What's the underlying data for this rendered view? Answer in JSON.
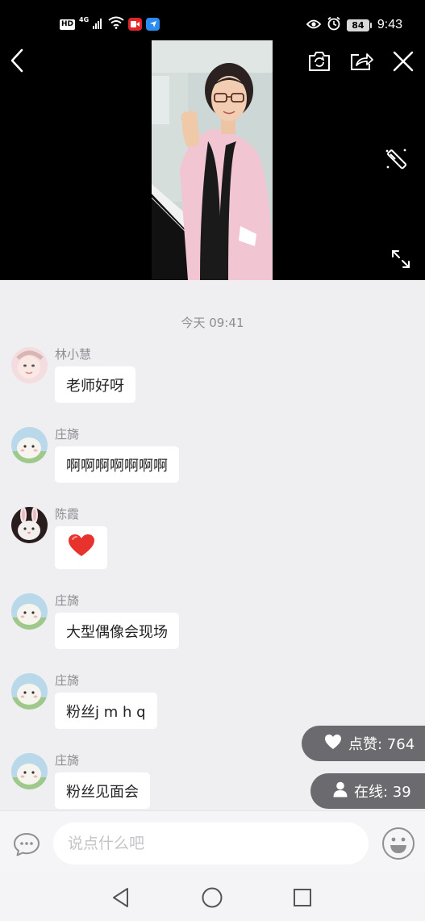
{
  "status_bar": {
    "hd": "HD",
    "network": "4G",
    "battery": "84",
    "time": "9:43"
  },
  "video": {
    "icons": [
      "back-icon",
      "switch-camera-icon",
      "share-icon",
      "close-icon",
      "beauty-wand-icon",
      "fullscreen-icon"
    ]
  },
  "chat": {
    "date_label": "今天 09:41",
    "messages": [
      {
        "sender": "林小慧",
        "text": "老师好呀",
        "avatar": "girl-avatar"
      },
      {
        "sender": "庄旖",
        "text": "啊啊啊啊啊啊啊",
        "avatar": "cartoon-avatar"
      },
      {
        "sender": "陈霞",
        "text": "",
        "sticker": "red-heart",
        "avatar": "bunny-avatar"
      },
      {
        "sender": "庄旖",
        "text": "大型偶像会现场",
        "avatar": "cartoon-avatar"
      },
      {
        "sender": "庄旖",
        "text": "粉丝j m h q",
        "avatar": "cartoon-avatar"
      },
      {
        "sender": "庄旖",
        "text": "粉丝见面会",
        "avatar": "cartoon-avatar"
      }
    ]
  },
  "stats": {
    "likes_label": "点赞: 764",
    "online_label": "在线: 39"
  },
  "input": {
    "placeholder": "说点什么吧"
  },
  "nav": {
    "icons": [
      "back-triangle-icon",
      "home-circle-icon",
      "recents-square-icon"
    ]
  },
  "colors": {
    "background": "#efeff2",
    "pill": "#6b6b6f",
    "heart": "#e8322d"
  }
}
